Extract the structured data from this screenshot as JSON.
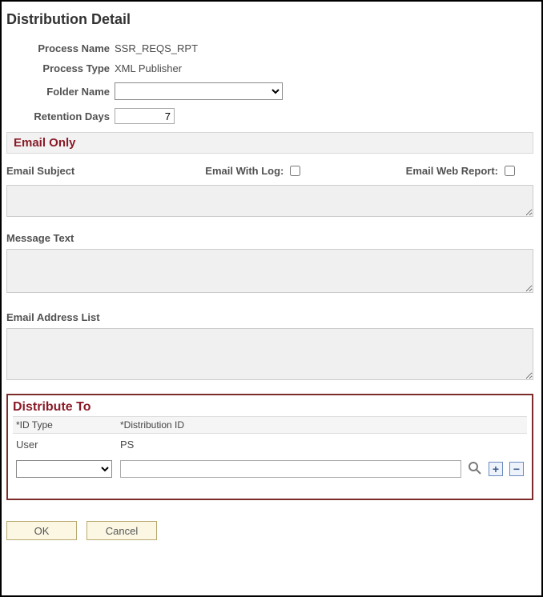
{
  "page": {
    "title": "Distribution Detail"
  },
  "form": {
    "process_name_label": "Process Name",
    "process_name_value": "SSR_REQS_RPT",
    "process_type_label": "Process Type",
    "process_type_value": "XML Publisher",
    "folder_name_label": "Folder Name",
    "folder_name_selected": "",
    "retention_days_label": "Retention Days",
    "retention_days_value": "7"
  },
  "email": {
    "section_title": "Email Only",
    "subject_label": "Email Subject",
    "with_log_label": "Email With Log:",
    "web_report_label": "Email Web Report:",
    "subject_value": "",
    "message_label": "Message Text",
    "message_value": "",
    "address_label": "Email Address List",
    "address_value": ""
  },
  "distribute": {
    "section_title": "Distribute To",
    "col_id_type": "*ID Type",
    "col_dist_id": "*Distribution ID",
    "rows": [
      {
        "id_type": "User",
        "dist_id": "PS"
      },
      {
        "id_type": "",
        "dist_id": ""
      }
    ]
  },
  "buttons": {
    "ok": "OK",
    "cancel": "Cancel"
  },
  "icons": {
    "lookup": "lookup-icon",
    "add": "+",
    "remove": "−"
  }
}
